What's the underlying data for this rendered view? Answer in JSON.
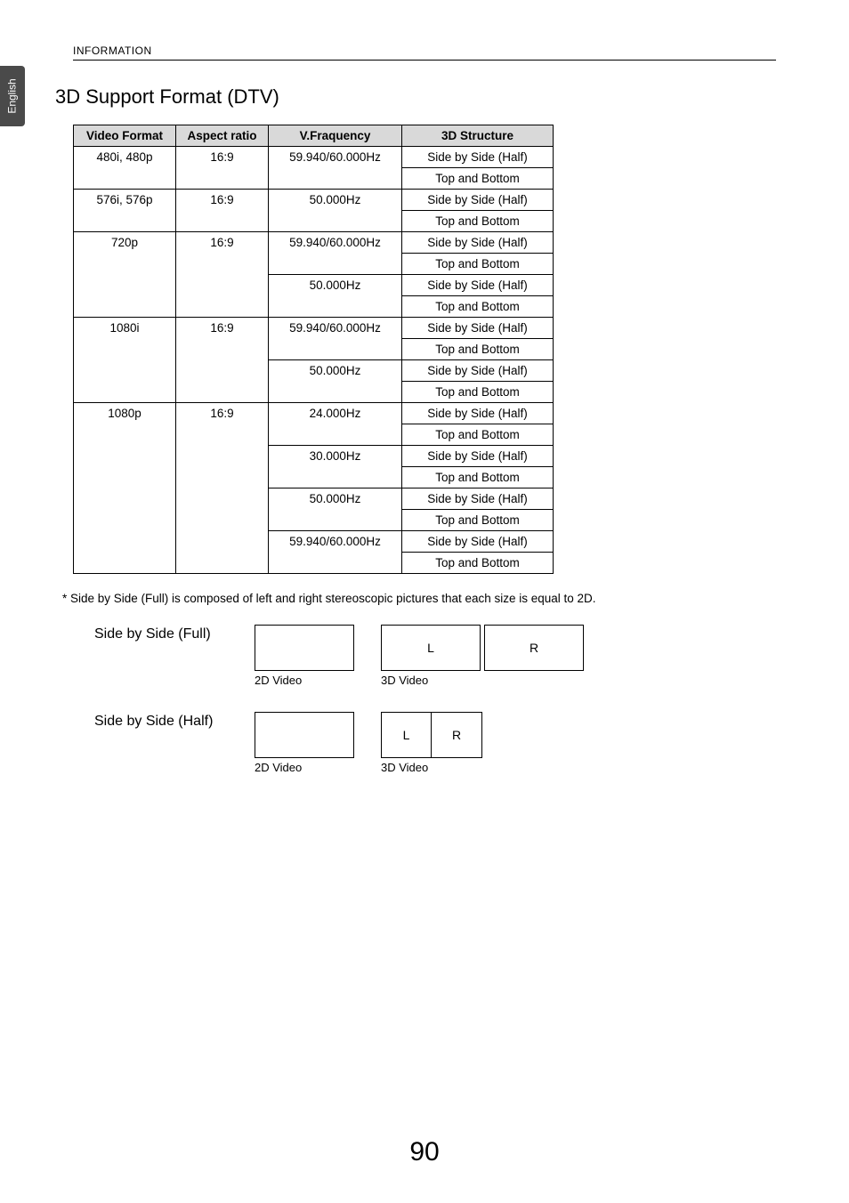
{
  "header": {
    "section": "INFORMATION",
    "language": "English"
  },
  "title": "3D Support Format (DTV)",
  "chart_data": {
    "type": "table",
    "headers": {
      "video_format": "Video Format",
      "aspect_ratio": "Aspect ratio",
      "vfreq": "V.Fraquency",
      "structure": "3D Structure"
    },
    "rows": [
      {
        "video_format": "480i, 480p",
        "aspect_ratio": "16:9",
        "vfreq": "59.940/60.000Hz",
        "structures": [
          "Side by Side (Half)",
          "Top and Bottom"
        ]
      },
      {
        "video_format": "576i, 576p",
        "aspect_ratio": "16:9",
        "vfreq": "50.000Hz",
        "structures": [
          "Side by Side (Half)",
          "Top and Bottom"
        ]
      },
      {
        "video_format": "720p",
        "aspect_ratio": "16:9",
        "freq_groups": [
          {
            "vfreq": "59.940/60.000Hz",
            "structures": [
              "Side by Side (Half)",
              "Top and Bottom"
            ]
          },
          {
            "vfreq": "50.000Hz",
            "structures": [
              "Side by Side (Half)",
              "Top and Bottom"
            ]
          }
        ]
      },
      {
        "video_format": "1080i",
        "aspect_ratio": "16:9",
        "freq_groups": [
          {
            "vfreq": "59.940/60.000Hz",
            "structures": [
              "Side by Side (Half)",
              "Top and Bottom"
            ]
          },
          {
            "vfreq": "50.000Hz",
            "structures": [
              "Side by Side (Half)",
              "Top and Bottom"
            ]
          }
        ]
      },
      {
        "video_format": "1080p",
        "aspect_ratio": "16:9",
        "freq_groups": [
          {
            "vfreq": "24.000Hz",
            "structures": [
              "Side by Side (Half)",
              "Top and Bottom"
            ]
          },
          {
            "vfreq": "30.000Hz",
            "structures": [
              "Side by Side (Half)",
              "Top and Bottom"
            ]
          },
          {
            "vfreq": "50.000Hz",
            "structures": [
              "Side by Side (Half)",
              "Top and Bottom"
            ]
          },
          {
            "vfreq": "59.940/60.000Hz",
            "structures": [
              "Side by Side (Half)",
              "Top and Bottom"
            ]
          }
        ]
      }
    ]
  },
  "footnote": "*  Side by Side (Full) is composed of left and right stereoscopic pictures that each size is equal to 2D.",
  "diagrams": {
    "full": {
      "label": "Side by Side (Full)",
      "cap2d": "2D Video",
      "cap3d": "3D Video",
      "L": "L",
      "R": "R"
    },
    "half": {
      "label": "Side by Side (Half)",
      "cap2d": "2D Video",
      "cap3d": "3D Video",
      "L": "L",
      "R": "R"
    }
  },
  "page_number": "90"
}
